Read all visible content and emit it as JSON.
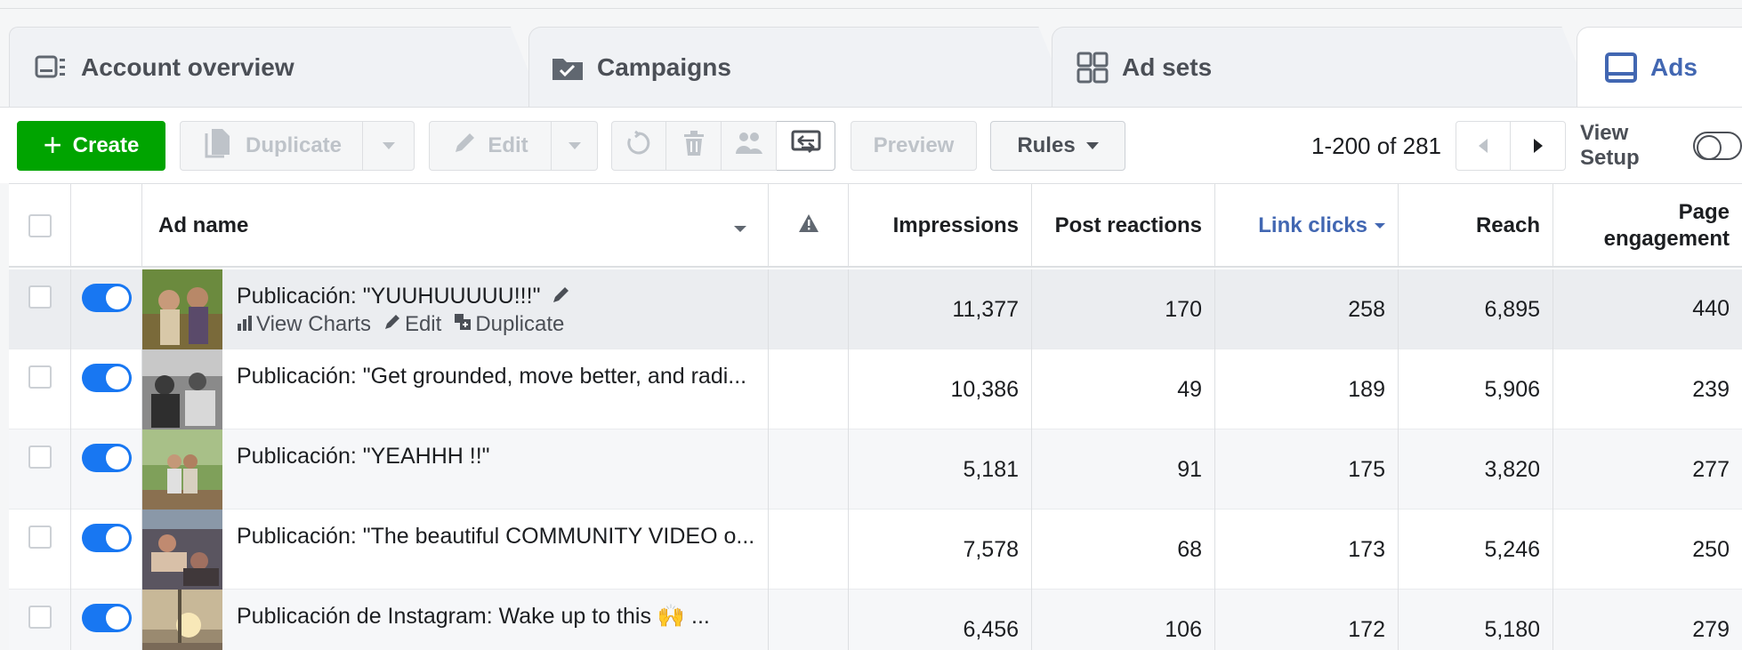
{
  "tabs": {
    "account_overview": "Account overview",
    "campaigns": "Campaigns",
    "ad_sets": "Ad sets",
    "ads": "Ads"
  },
  "toolbar": {
    "create": "Create",
    "duplicate": "Duplicate",
    "edit": "Edit",
    "preview": "Preview",
    "rules": "Rules",
    "pagination": "1-200 of 281",
    "view_setup": "View Setup"
  },
  "table": {
    "headers": {
      "ad_name": "Ad name",
      "impressions": "Impressions",
      "post_reactions": "Post reactions",
      "link_clicks": "Link clicks",
      "reach": "Reach",
      "page_engagement": "Page engagement"
    },
    "row_actions": {
      "view_charts": "View Charts",
      "edit": "Edit",
      "duplicate": "Duplicate"
    },
    "rows": [
      {
        "name": "Publicación: \"YUUHUUUUU!!!\"",
        "impressions": "11,377",
        "post_reactions": "170",
        "link_clicks": "258",
        "reach": "6,895",
        "page_engagement": "440"
      },
      {
        "name": "Publicación: \"Get grounded, move better, and radi...",
        "impressions": "10,386",
        "post_reactions": "49",
        "link_clicks": "189",
        "reach": "5,906",
        "page_engagement": "239"
      },
      {
        "name": "Publicación: \"YEAHHH !!\"",
        "impressions": "5,181",
        "post_reactions": "91",
        "link_clicks": "175",
        "reach": "3,820",
        "page_engagement": "277"
      },
      {
        "name": "Publicación: \"The beautiful COMMUNITY VIDEO o...",
        "impressions": "7,578",
        "post_reactions": "68",
        "link_clicks": "173",
        "reach": "5,246",
        "page_engagement": "250"
      },
      {
        "name": "Publicación de Instagram: Wake up to this 🙌 ...",
        "impressions": "6,456",
        "post_reactions": "106",
        "link_clicks": "172",
        "reach": "5,180",
        "page_engagement": "279"
      }
    ]
  },
  "colors": {
    "create_green": "#00a400",
    "toggle_blue": "#1877f2",
    "active_tab_blue": "#4267b2"
  }
}
